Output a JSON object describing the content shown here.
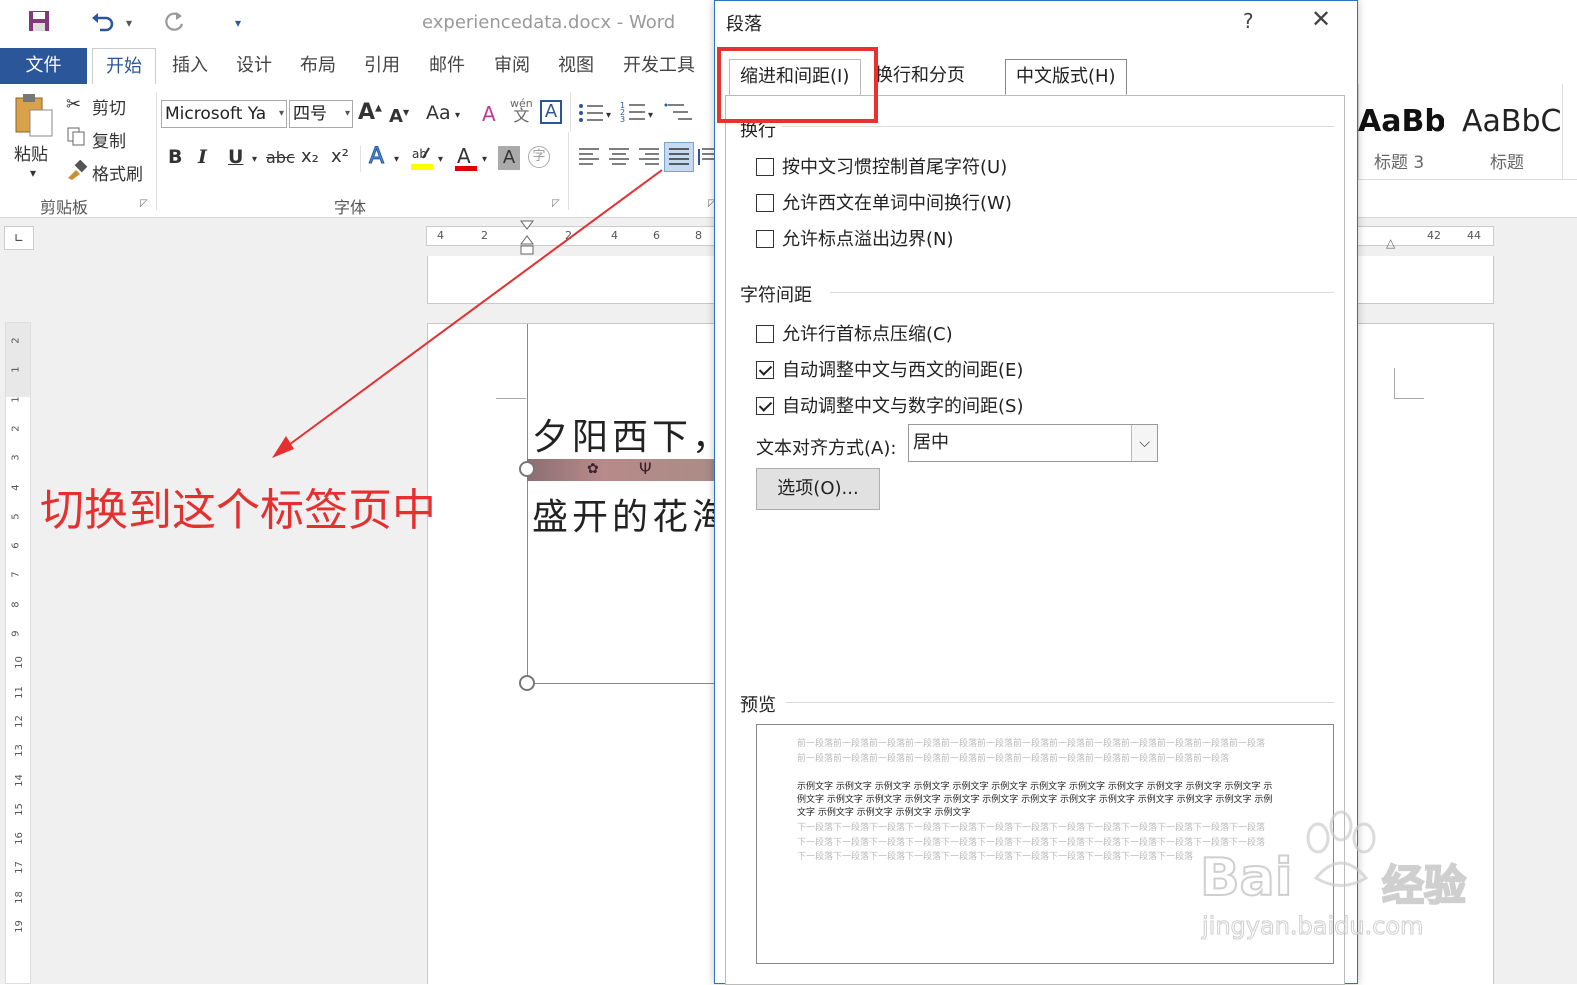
{
  "window": {
    "doc_title": "experiencedata.docx - Word",
    "qat": {
      "save_icon": "save-icon",
      "undo_icon": "undo-icon",
      "redo_icon": "redo-icon",
      "customize_icon": "customize-icon"
    }
  },
  "menu": {
    "tabs": [
      "文件",
      "开始",
      "插入",
      "设计",
      "布局",
      "引用",
      "邮件",
      "审阅",
      "视图",
      "开发工具"
    ],
    "active_tab": "开始"
  },
  "ribbon": {
    "clipboard": {
      "paste": "粘贴",
      "cut": "剪切",
      "copy": "复制",
      "format_painter": "格式刷",
      "group_label": "剪贴板"
    },
    "font": {
      "name": "Microsoft Ya",
      "size": "四号",
      "case": "Aa",
      "bold": "B",
      "italic": "I",
      "underline": "U",
      "strike": "abc",
      "subscript": "x₂",
      "superscript": "x²",
      "group_label": "字体"
    },
    "styles": [
      {
        "sample": "AaBb(",
        "label": "标题 3"
      },
      {
        "sample": "AaBbC",
        "label": "标题"
      }
    ]
  },
  "ruler": {
    "left_ticks": [
      "4",
      "2",
      "2",
      "4",
      "6",
      "8"
    ],
    "right_ticks": [
      "42",
      "44"
    ]
  },
  "vertical_ruler": [
    "2",
    "1",
    "1",
    "2",
    "3",
    "4",
    "5",
    "6",
    "7",
    "8",
    "9",
    "10",
    "11",
    "12",
    "13",
    "14",
    "15",
    "16",
    "17",
    "18",
    "19"
  ],
  "document": {
    "line1": "夕阳西下，",
    "line2": "盛开的花海"
  },
  "annotation": {
    "text": "切换到这个标签页中",
    "color": "#e53030"
  },
  "dialog": {
    "title": "段落",
    "help": "?",
    "close": "✕",
    "tabs": [
      "缩进和间距(I)",
      "换行和分页(P)",
      "中文版式(H)"
    ],
    "active_tab": "中文版式(H)",
    "line_break_section": "换行",
    "line_break_options": [
      {
        "label": "按中文习惯控制首尾字符(U)",
        "checked": false
      },
      {
        "label": "允许西文在单词中间换行(W)",
        "checked": false
      },
      {
        "label": "允许标点溢出边界(N)",
        "checked": false
      }
    ],
    "char_spacing_section": "字符间距",
    "char_spacing_options": [
      {
        "label": "允许行首标点压缩(C)",
        "checked": false
      },
      {
        "label": "自动调整中文与西文的间距(E)",
        "checked": true
      },
      {
        "label": "自动调整中文与数字的间距(S)",
        "checked": true
      }
    ],
    "text_align": {
      "label": "文本对齐方式(A):",
      "value": "居中"
    },
    "options_button": "选项(O)...",
    "preview_section": "预览",
    "preview": {
      "prev": "前一段落前一段落前一段落前一段落前一段落前一段落前一段落前一段落前一段落前一段落前一段落前一段落前一段落前一段落前一段落前一段落前一段落前一段落前一段落前一段落前一段落前一段落前一段落前一段落前一段落",
      "sample": "示例文字 示例文字 示例文字 示例文字 示例文字 示例文字 示例文字 示例文字 示例文字 示例文字 示例文字 示例文字 示例文字 示例文字 示例文字 示例文字 示例文字 示例文字 示例文字 示例文字 示例文字 示例文字 示例文字 示例文字 示例文字 示例文字 示例文字 示例文字 示例文字",
      "next": "下一段落下一段落下一段落下一段落下一段落下一段落下一段落下一段落下一段落下一段落下一段落下一段落下一段落下一段落下一段落下一段落下一段落下一段落下一段落下一段落下一段落下一段落下一段落下一段落下一段落下一段落下一段落下一段落下一段落下一段落下一段落下一段落下一段落下一段落下一段落下一段落下一段落"
    }
  },
  "watermark": {
    "brand": "Bai",
    "suffix": "经验",
    "url": "jingyan.baidu.com"
  }
}
